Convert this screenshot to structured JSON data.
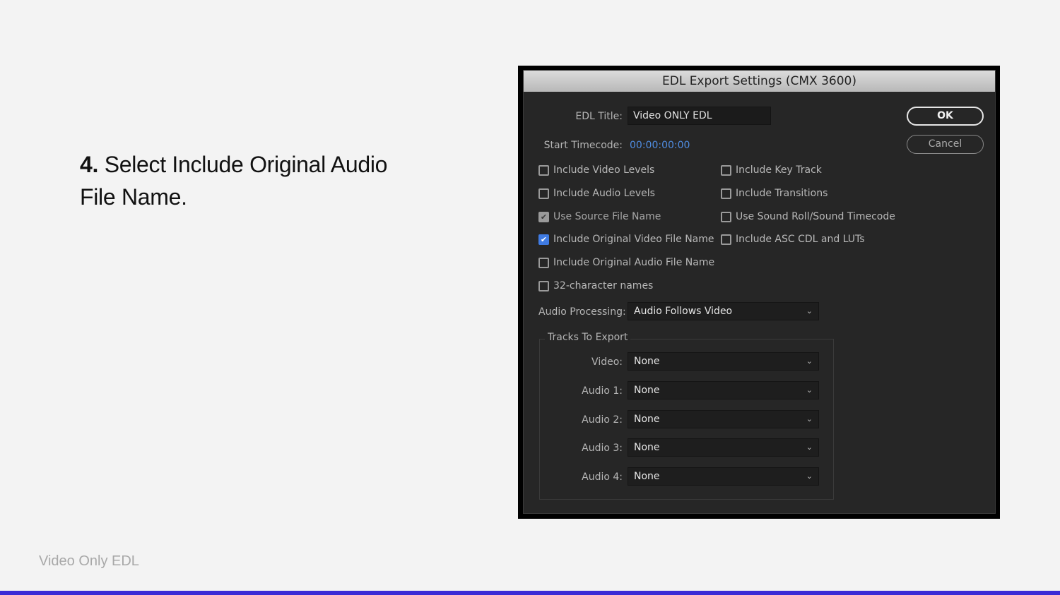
{
  "slide": {
    "step_number": "4.",
    "step_text": "Select Include Original Audio File Name.",
    "footer_label": "Video Only EDL",
    "accent_color": "#3b2bd6"
  },
  "dialog": {
    "title": "EDL Export Settings (CMX 3600)",
    "edl_title_label": "EDL Title:",
    "edl_title_value": "Video ONLY EDL",
    "start_timecode_label": "Start Timecode:",
    "start_timecode_value": "00:00:00:00",
    "ok_label": "OK",
    "cancel_label": "Cancel",
    "options_left": [
      {
        "label": "Include Video Levels",
        "checked": false
      },
      {
        "label": "Include Audio Levels",
        "checked": false
      },
      {
        "label": "Use Source File Name",
        "checked": true,
        "disabled": true
      },
      {
        "label": "Include Original Video File Name",
        "checked": true
      },
      {
        "label": "Include Original Audio File Name",
        "checked": false
      },
      {
        "label": "32-character names",
        "checked": false
      }
    ],
    "options_right": [
      {
        "label": "Include Key Track",
        "checked": false
      },
      {
        "label": "Include Transitions",
        "checked": false
      },
      {
        "label": "Use Sound Roll/Sound Timecode",
        "checked": false
      },
      {
        "label": "Include ASC CDL and LUTs",
        "checked": false
      }
    ],
    "audio_processing_label": "Audio Processing:",
    "audio_processing_value": "Audio Follows Video",
    "tracks_group_title": "Tracks To Export",
    "tracks": [
      {
        "label": "Video:",
        "value": "None"
      },
      {
        "label": "Audio 1:",
        "value": "None"
      },
      {
        "label": "Audio 2:",
        "value": "None"
      },
      {
        "label": "Audio 3:",
        "value": "None"
      },
      {
        "label": "Audio 4:",
        "value": "None"
      }
    ],
    "checkbox_accent": "#3f7be3",
    "timecode_color": "#4f8ce0"
  }
}
